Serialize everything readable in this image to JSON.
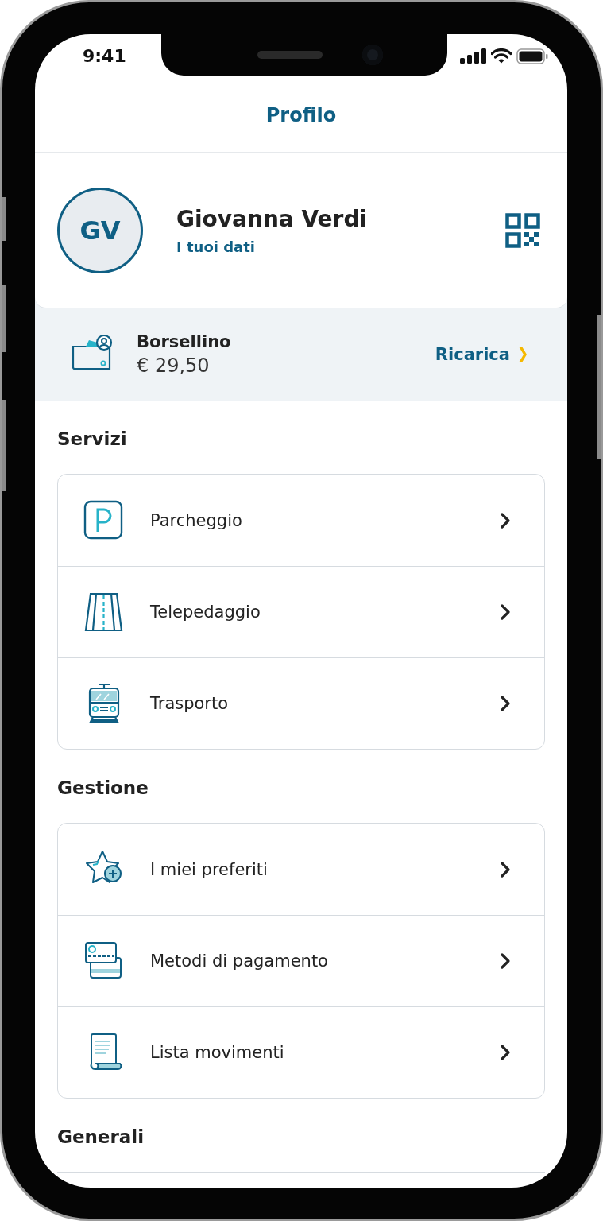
{
  "status_bar": {
    "time": "9:41"
  },
  "header": {
    "title": "Profilo"
  },
  "profile": {
    "initials": "GV",
    "name": "Giovanna Verdi",
    "link": "I tuoi dati"
  },
  "wallet": {
    "title": "Borsellino",
    "balance": "€ 29,50",
    "action": "Ricarica"
  },
  "sections": [
    {
      "title": "Servizi",
      "items": [
        {
          "label": "Parcheggio",
          "kind": "parking"
        },
        {
          "label": "Telepedaggio",
          "kind": "road"
        },
        {
          "label": "Trasporto",
          "kind": "train"
        }
      ]
    },
    {
      "title": "Gestione",
      "items": [
        {
          "label": "I miei preferiti",
          "kind": "star"
        },
        {
          "label": "Metodi di pagamento",
          "kind": "cards"
        },
        {
          "label": "Lista movimenti",
          "kind": "receipt"
        }
      ]
    },
    {
      "title": "Generali"
    }
  ]
}
